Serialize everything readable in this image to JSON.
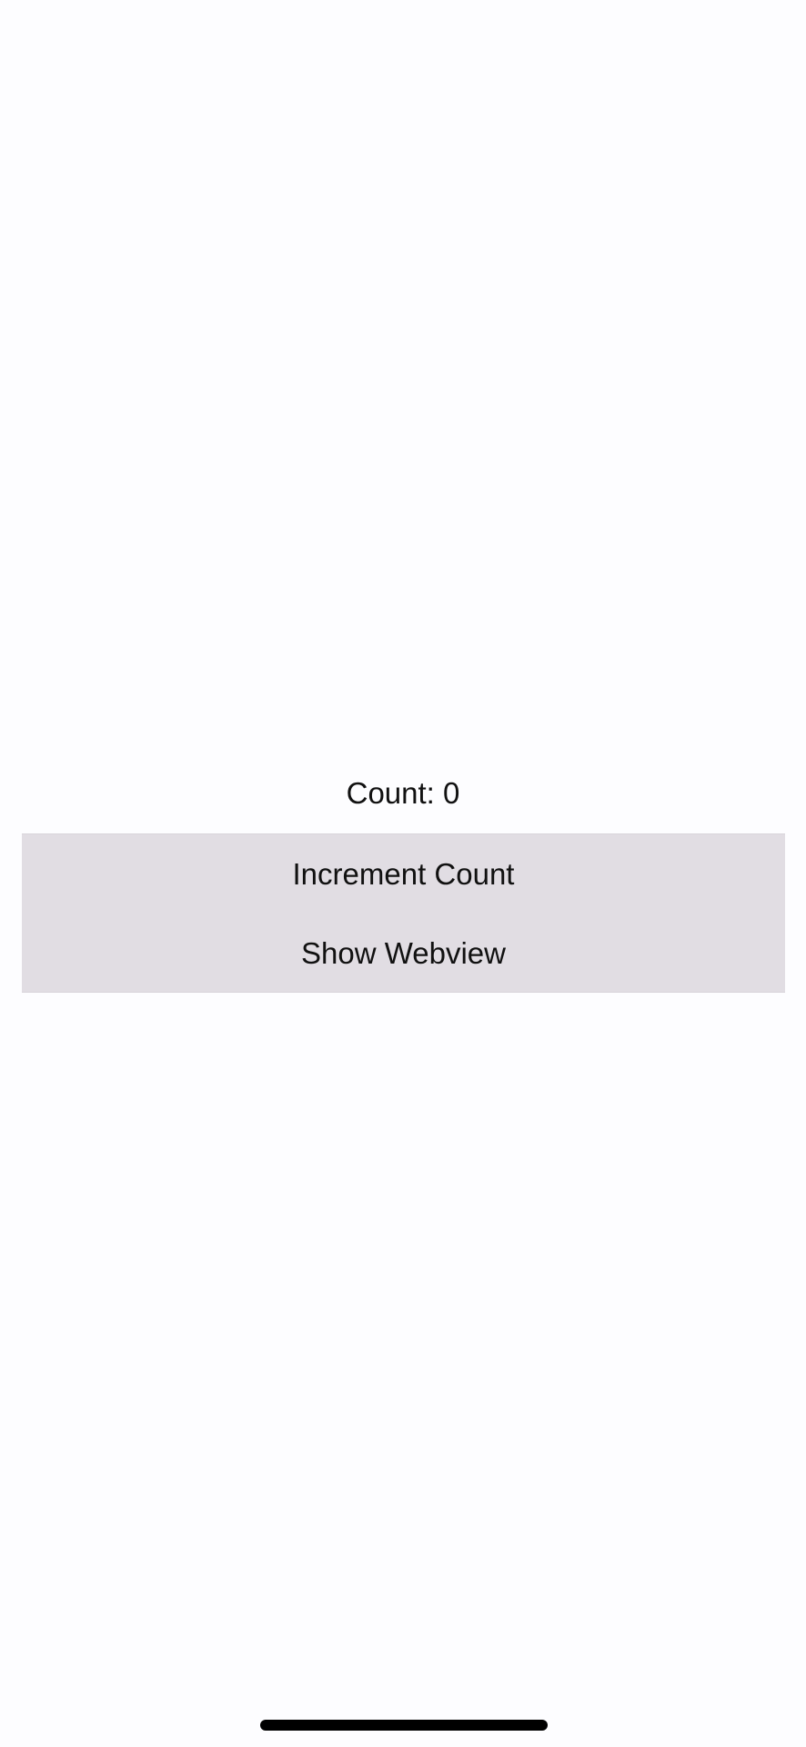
{
  "counter": {
    "label": "Count: 0"
  },
  "buttons": {
    "increment_label": "Increment Count",
    "webview_label": "Show Webview"
  },
  "colors": {
    "background": "#fdfdff",
    "button_group_bg": "#e1dde3",
    "text": "#111111",
    "home_indicator": "#000000"
  }
}
